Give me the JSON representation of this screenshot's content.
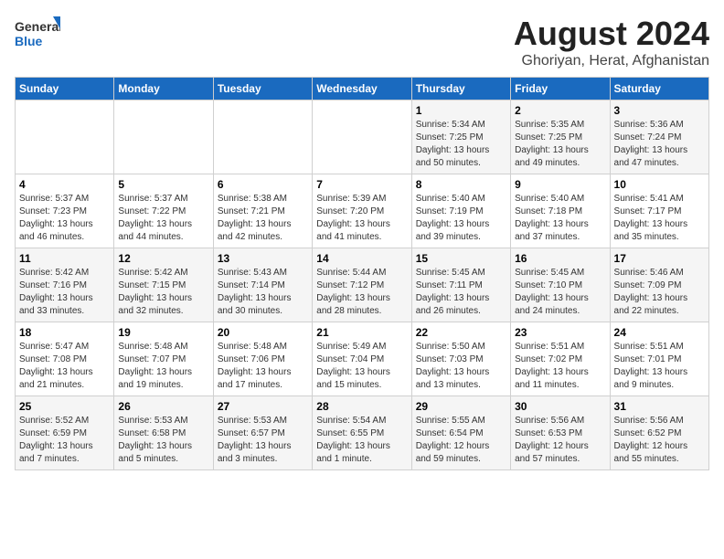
{
  "logo": {
    "text_general": "General",
    "text_blue": "Blue"
  },
  "header": {
    "title": "August 2024",
    "subtitle": "Ghoriyan, Herat, Afghanistan"
  },
  "weekdays": [
    "Sunday",
    "Monday",
    "Tuesday",
    "Wednesday",
    "Thursday",
    "Friday",
    "Saturday"
  ],
  "weeks": [
    [
      {
        "day": "",
        "sunrise": "",
        "sunset": "",
        "daylight": ""
      },
      {
        "day": "",
        "sunrise": "",
        "sunset": "",
        "daylight": ""
      },
      {
        "day": "",
        "sunrise": "",
        "sunset": "",
        "daylight": ""
      },
      {
        "day": "",
        "sunrise": "",
        "sunset": "",
        "daylight": ""
      },
      {
        "day": "1",
        "sunrise": "Sunrise: 5:34 AM",
        "sunset": "Sunset: 7:25 PM",
        "daylight": "Daylight: 13 hours and 50 minutes."
      },
      {
        "day": "2",
        "sunrise": "Sunrise: 5:35 AM",
        "sunset": "Sunset: 7:25 PM",
        "daylight": "Daylight: 13 hours and 49 minutes."
      },
      {
        "day": "3",
        "sunrise": "Sunrise: 5:36 AM",
        "sunset": "Sunset: 7:24 PM",
        "daylight": "Daylight: 13 hours and 47 minutes."
      }
    ],
    [
      {
        "day": "4",
        "sunrise": "Sunrise: 5:37 AM",
        "sunset": "Sunset: 7:23 PM",
        "daylight": "Daylight: 13 hours and 46 minutes."
      },
      {
        "day": "5",
        "sunrise": "Sunrise: 5:37 AM",
        "sunset": "Sunset: 7:22 PM",
        "daylight": "Daylight: 13 hours and 44 minutes."
      },
      {
        "day": "6",
        "sunrise": "Sunrise: 5:38 AM",
        "sunset": "Sunset: 7:21 PM",
        "daylight": "Daylight: 13 hours and 42 minutes."
      },
      {
        "day": "7",
        "sunrise": "Sunrise: 5:39 AM",
        "sunset": "Sunset: 7:20 PM",
        "daylight": "Daylight: 13 hours and 41 minutes."
      },
      {
        "day": "8",
        "sunrise": "Sunrise: 5:40 AM",
        "sunset": "Sunset: 7:19 PM",
        "daylight": "Daylight: 13 hours and 39 minutes."
      },
      {
        "day": "9",
        "sunrise": "Sunrise: 5:40 AM",
        "sunset": "Sunset: 7:18 PM",
        "daylight": "Daylight: 13 hours and 37 minutes."
      },
      {
        "day": "10",
        "sunrise": "Sunrise: 5:41 AM",
        "sunset": "Sunset: 7:17 PM",
        "daylight": "Daylight: 13 hours and 35 minutes."
      }
    ],
    [
      {
        "day": "11",
        "sunrise": "Sunrise: 5:42 AM",
        "sunset": "Sunset: 7:16 PM",
        "daylight": "Daylight: 13 hours and 33 minutes."
      },
      {
        "day": "12",
        "sunrise": "Sunrise: 5:42 AM",
        "sunset": "Sunset: 7:15 PM",
        "daylight": "Daylight: 13 hours and 32 minutes."
      },
      {
        "day": "13",
        "sunrise": "Sunrise: 5:43 AM",
        "sunset": "Sunset: 7:14 PM",
        "daylight": "Daylight: 13 hours and 30 minutes."
      },
      {
        "day": "14",
        "sunrise": "Sunrise: 5:44 AM",
        "sunset": "Sunset: 7:12 PM",
        "daylight": "Daylight: 13 hours and 28 minutes."
      },
      {
        "day": "15",
        "sunrise": "Sunrise: 5:45 AM",
        "sunset": "Sunset: 7:11 PM",
        "daylight": "Daylight: 13 hours and 26 minutes."
      },
      {
        "day": "16",
        "sunrise": "Sunrise: 5:45 AM",
        "sunset": "Sunset: 7:10 PM",
        "daylight": "Daylight: 13 hours and 24 minutes."
      },
      {
        "day": "17",
        "sunrise": "Sunrise: 5:46 AM",
        "sunset": "Sunset: 7:09 PM",
        "daylight": "Daylight: 13 hours and 22 minutes."
      }
    ],
    [
      {
        "day": "18",
        "sunrise": "Sunrise: 5:47 AM",
        "sunset": "Sunset: 7:08 PM",
        "daylight": "Daylight: 13 hours and 21 minutes."
      },
      {
        "day": "19",
        "sunrise": "Sunrise: 5:48 AM",
        "sunset": "Sunset: 7:07 PM",
        "daylight": "Daylight: 13 hours and 19 minutes."
      },
      {
        "day": "20",
        "sunrise": "Sunrise: 5:48 AM",
        "sunset": "Sunset: 7:06 PM",
        "daylight": "Daylight: 13 hours and 17 minutes."
      },
      {
        "day": "21",
        "sunrise": "Sunrise: 5:49 AM",
        "sunset": "Sunset: 7:04 PM",
        "daylight": "Daylight: 13 hours and 15 minutes."
      },
      {
        "day": "22",
        "sunrise": "Sunrise: 5:50 AM",
        "sunset": "Sunset: 7:03 PM",
        "daylight": "Daylight: 13 hours and 13 minutes."
      },
      {
        "day": "23",
        "sunrise": "Sunrise: 5:51 AM",
        "sunset": "Sunset: 7:02 PM",
        "daylight": "Daylight: 13 hours and 11 minutes."
      },
      {
        "day": "24",
        "sunrise": "Sunrise: 5:51 AM",
        "sunset": "Sunset: 7:01 PM",
        "daylight": "Daylight: 13 hours and 9 minutes."
      }
    ],
    [
      {
        "day": "25",
        "sunrise": "Sunrise: 5:52 AM",
        "sunset": "Sunset: 6:59 PM",
        "daylight": "Daylight: 13 hours and 7 minutes."
      },
      {
        "day": "26",
        "sunrise": "Sunrise: 5:53 AM",
        "sunset": "Sunset: 6:58 PM",
        "daylight": "Daylight: 13 hours and 5 minutes."
      },
      {
        "day": "27",
        "sunrise": "Sunrise: 5:53 AM",
        "sunset": "Sunset: 6:57 PM",
        "daylight": "Daylight: 13 hours and 3 minutes."
      },
      {
        "day": "28",
        "sunrise": "Sunrise: 5:54 AM",
        "sunset": "Sunset: 6:55 PM",
        "daylight": "Daylight: 13 hours and 1 minute."
      },
      {
        "day": "29",
        "sunrise": "Sunrise: 5:55 AM",
        "sunset": "Sunset: 6:54 PM",
        "daylight": "Daylight: 12 hours and 59 minutes."
      },
      {
        "day": "30",
        "sunrise": "Sunrise: 5:56 AM",
        "sunset": "Sunset: 6:53 PM",
        "daylight": "Daylight: 12 hours and 57 minutes."
      },
      {
        "day": "31",
        "sunrise": "Sunrise: 5:56 AM",
        "sunset": "Sunset: 6:52 PM",
        "daylight": "Daylight: 12 hours and 55 minutes."
      }
    ]
  ]
}
